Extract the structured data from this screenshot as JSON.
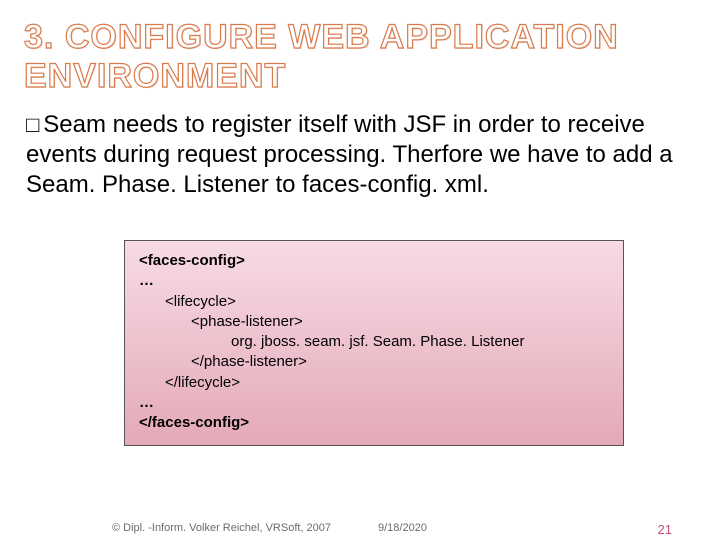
{
  "title": {
    "number": "3.",
    "rest": "CONFIGURE WEB APPLICATION ENVIRONMENT"
  },
  "body": {
    "bullet": "□",
    "text": "Seam needs to register itself with JSF in order to receive events during request processing. Therfore we have to add a Seam. Phase. Listener to faces-config. xml."
  },
  "code": {
    "l1": "<faces-config>",
    "l2": "…",
    "l3": "<lifecycle>",
    "l4": "<phase-listener>",
    "l5": "org. jboss. seam. jsf. Seam. Phase. Listener",
    "l6": "</phase-listener>",
    "l7": "</lifecycle>",
    "l8": "…",
    "l9": "</faces-config>"
  },
  "footer": {
    "copyright": "© Dipl. -Inform. Volker Reichel, VRSoft, 2007",
    "date": "9/18/2020",
    "page": "21"
  }
}
